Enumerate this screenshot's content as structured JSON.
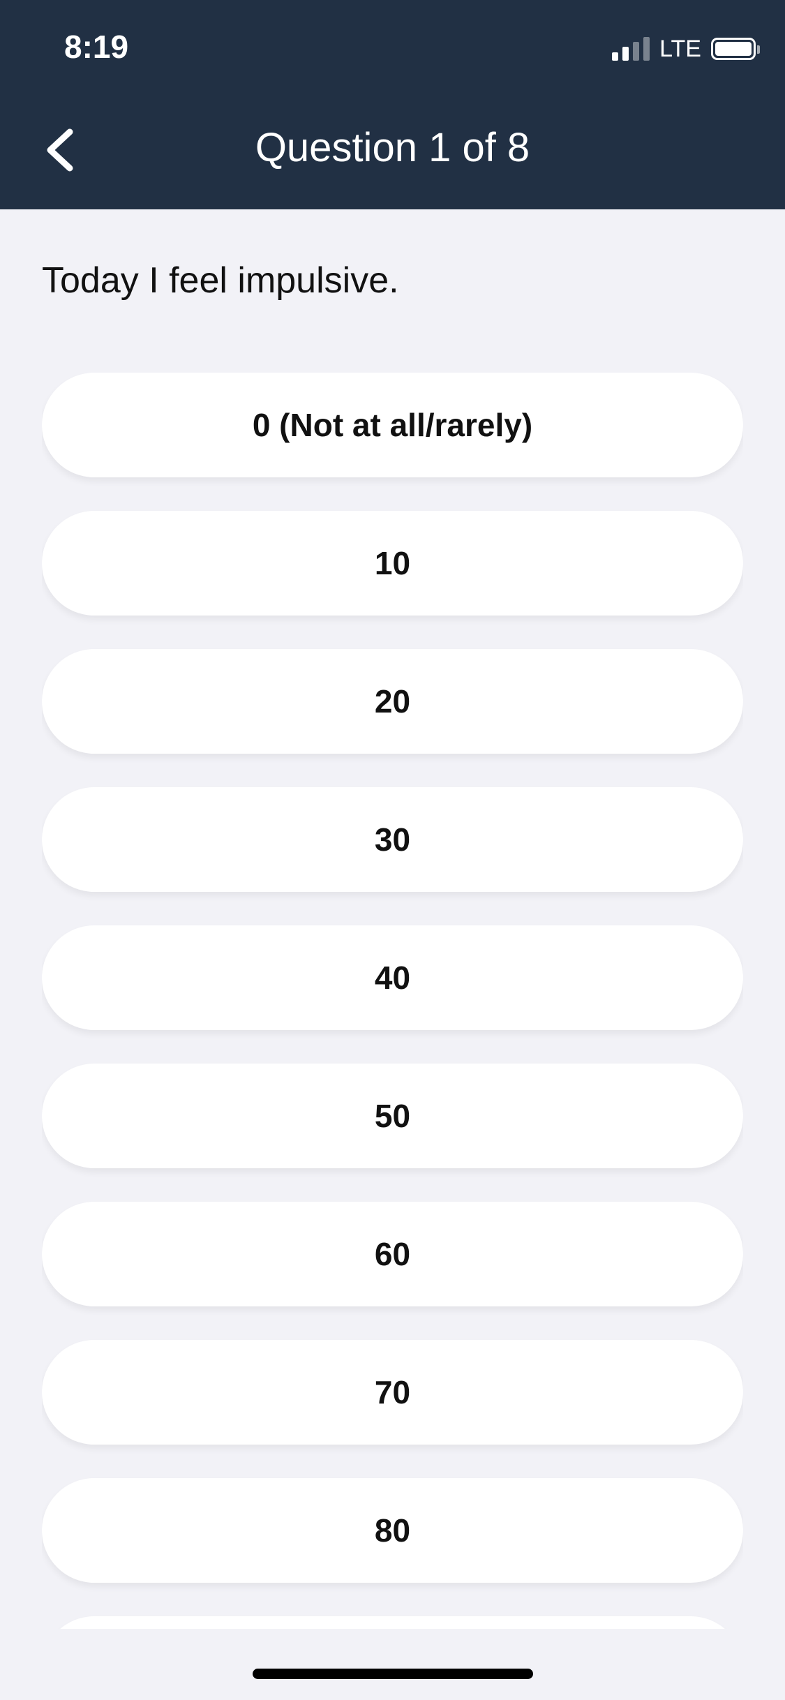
{
  "status_bar": {
    "time": "8:19",
    "network": "LTE",
    "signal_bars_active": 2,
    "signal_bars_total": 4,
    "battery_level": 1.0
  },
  "header": {
    "title": "Question 1 of 8",
    "background_color": "#213044",
    "back_icon": "chevron-left-icon"
  },
  "question": {
    "text": "Today I feel impulsive."
  },
  "options": [
    {
      "label": "0 (Not at all/rarely)"
    },
    {
      "label": "10"
    },
    {
      "label": "20"
    },
    {
      "label": "30"
    },
    {
      "label": "40"
    },
    {
      "label": "50"
    },
    {
      "label": "60"
    },
    {
      "label": "70"
    },
    {
      "label": "80"
    },
    {
      "label": ""
    }
  ],
  "colors": {
    "page_background": "#f2f2f7",
    "option_background": "#ffffff",
    "text": "#111111"
  }
}
